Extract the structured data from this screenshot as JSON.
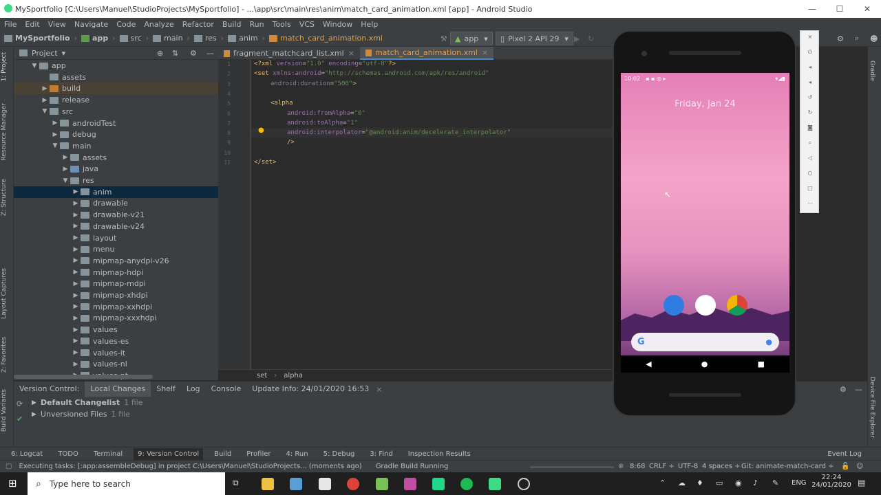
{
  "window": {
    "title": "MySportfolio [C:\\Users\\Manuel\\StudioProjects\\MySportfolio] - ...\\app\\src\\main\\res\\anim\\match_card_animation.xml [app] - Android Studio",
    "minimize": "—",
    "maximize": "☐",
    "close": "✕"
  },
  "menu": [
    "File",
    "Edit",
    "View",
    "Navigate",
    "Code",
    "Analyze",
    "Refactor",
    "Build",
    "Run",
    "Tools",
    "VCS",
    "Window",
    "Help"
  ],
  "breadcrumbs": [
    "MySportfolio",
    "app",
    "src",
    "main",
    "res",
    "anim",
    "match_card_animation.xml"
  ],
  "toolbar": {
    "run_config": "app",
    "device": "Pixel 2 API 29"
  },
  "left_strip": {
    "project": "1: Project",
    "resource": "Resource Manager",
    "structure": "Z: Structure",
    "captures": "Layout Captures",
    "favorites": "2: Favorites",
    "variants": "Build Variants"
  },
  "project_panel": {
    "title": "Project"
  },
  "tree": [
    {
      "label": "app",
      "depth": 1,
      "arrow": "▼",
      "color": "gray"
    },
    {
      "label": "assets",
      "depth": 2,
      "arrow": "",
      "color": "gray"
    },
    {
      "label": "build",
      "depth": 2,
      "arrow": "▶",
      "color": "orange"
    },
    {
      "label": "release",
      "depth": 2,
      "arrow": "▶",
      "color": "gray"
    },
    {
      "label": "src",
      "depth": 2,
      "arrow": "▼",
      "color": "gray"
    },
    {
      "label": "androidTest",
      "depth": 3,
      "arrow": "▶",
      "color": "gray"
    },
    {
      "label": "debug",
      "depth": 3,
      "arrow": "▶",
      "color": "gray"
    },
    {
      "label": "main",
      "depth": 3,
      "arrow": "▼",
      "color": "gray"
    },
    {
      "label": "assets",
      "depth": 4,
      "arrow": "▶",
      "color": "gray"
    },
    {
      "label": "java",
      "depth": 4,
      "arrow": "▶",
      "color": "blue"
    },
    {
      "label": "res",
      "depth": 4,
      "arrow": "▼",
      "color": "gray"
    },
    {
      "label": "anim",
      "depth": 5,
      "arrow": "▶",
      "color": "gray",
      "selected": true
    },
    {
      "label": "drawable",
      "depth": 5,
      "arrow": "▶",
      "color": "gray"
    },
    {
      "label": "drawable-v21",
      "depth": 5,
      "arrow": "▶",
      "color": "gray"
    },
    {
      "label": "drawable-v24",
      "depth": 5,
      "arrow": "▶",
      "color": "gray"
    },
    {
      "label": "layout",
      "depth": 5,
      "arrow": "▶",
      "color": "gray"
    },
    {
      "label": "menu",
      "depth": 5,
      "arrow": "▶",
      "color": "gray"
    },
    {
      "label": "mipmap-anydpi-v26",
      "depth": 5,
      "arrow": "▶",
      "color": "gray"
    },
    {
      "label": "mipmap-hdpi",
      "depth": 5,
      "arrow": "▶",
      "color": "gray"
    },
    {
      "label": "mipmap-mdpi",
      "depth": 5,
      "arrow": "▶",
      "color": "gray"
    },
    {
      "label": "mipmap-xhdpi",
      "depth": 5,
      "arrow": "▶",
      "color": "gray"
    },
    {
      "label": "mipmap-xxhdpi",
      "depth": 5,
      "arrow": "▶",
      "color": "gray"
    },
    {
      "label": "mipmap-xxxhdpi",
      "depth": 5,
      "arrow": "▶",
      "color": "gray"
    },
    {
      "label": "values",
      "depth": 5,
      "arrow": "▶",
      "color": "gray"
    },
    {
      "label": "values-es",
      "depth": 5,
      "arrow": "▶",
      "color": "gray"
    },
    {
      "label": "values-it",
      "depth": 5,
      "arrow": "▶",
      "color": "gray"
    },
    {
      "label": "values-nl",
      "depth": 5,
      "arrow": "▶",
      "color": "gray"
    },
    {
      "label": "values-pt",
      "depth": 5,
      "arrow": "▶",
      "color": "gray"
    }
  ],
  "editor_tabs": [
    {
      "label": "fragment_matchcard_list.xml",
      "active": false
    },
    {
      "label": "match_card_animation.xml",
      "active": true
    }
  ],
  "code_lines": [
    {
      "n": "1",
      "parts": [
        [
          "kw",
          "<?xml "
        ],
        [
          "attr",
          "version"
        ],
        [
          "pl",
          "="
        ],
        [
          "str",
          "\"1.0\""
        ],
        [
          "pl",
          " "
        ],
        [
          "attr",
          "encoding"
        ],
        [
          "pl",
          "="
        ],
        [
          "str",
          "\"utf-8\""
        ],
        [
          "kw",
          "?>"
        ]
      ],
      "indent": 0
    },
    {
      "n": "2",
      "parts": [
        [
          "kw",
          "<set "
        ],
        [
          "attr",
          "xmlns:android"
        ],
        [
          "pl",
          "="
        ],
        [
          "str",
          "\"http://schemas.android.com/apk/res/android\""
        ]
      ],
      "indent": 0
    },
    {
      "n": "3",
      "parts": [
        [
          "attr",
          "android:duration"
        ],
        [
          "pl",
          "="
        ],
        [
          "str",
          "\"500\""
        ],
        [
          "kw",
          ">"
        ]
      ],
      "indent": 2
    },
    {
      "n": "4",
      "parts": [],
      "indent": 0
    },
    {
      "n": "5",
      "parts": [
        [
          "kw",
          "<alpha"
        ]
      ],
      "indent": 2
    },
    {
      "n": "6",
      "parts": [
        [
          "attr",
          "android:fromAlpha"
        ],
        [
          "pl",
          "="
        ],
        [
          "str",
          "\"0\""
        ]
      ],
      "indent": 4
    },
    {
      "n": "7",
      "parts": [
        [
          "attr",
          "android:toAlpha"
        ],
        [
          "pl",
          "="
        ],
        [
          "str",
          "\"1\""
        ]
      ],
      "indent": 4
    },
    {
      "n": "8",
      "parts": [
        [
          "attr",
          "android:interpolator"
        ],
        [
          "pl",
          "="
        ],
        [
          "str",
          "\"@android:anim/decelerate_interpolator\""
        ]
      ],
      "indent": 4
    },
    {
      "n": "9",
      "parts": [
        [
          "kw",
          "/>"
        ]
      ],
      "indent": 4
    },
    {
      "n": "10",
      "parts": [],
      "indent": 0
    },
    {
      "n": "11",
      "parts": [
        [
          "kw",
          "</set>"
        ]
      ],
      "indent": 0
    }
  ],
  "editor_breadcrumb": [
    "set",
    "alpha"
  ],
  "version_control": {
    "label": "Version Control:",
    "tabs": [
      "Local Changes",
      "Shelf",
      "Log",
      "Console",
      "Update Info: 24/01/2020 16:53"
    ],
    "changelist": "Default Changelist",
    "changelist_count": "1 file",
    "unversioned": "Unversioned Files",
    "unversioned_count": "1 file"
  },
  "bottom_tabs": [
    "6: Logcat",
    "TODO",
    "Terminal",
    "9: Version Control",
    "Build",
    "Profiler",
    "4: Run",
    "5: Debug",
    "3: Find",
    "Inspection Results"
  ],
  "event_log": "Event Log",
  "status": {
    "message": "Executing tasks: [:app:assembleDebug] in project C:\\Users\\Manuel\\StudioProjects... (moments ago)",
    "gradle": "Gradle Build Running",
    "position": "8:68",
    "line_sep": "CRLF ÷",
    "encoding": "UTF-8",
    "indent": "4 spaces ÷",
    "git": "Git: animate-match-card ÷"
  },
  "right_strip": {
    "gradle": "Gradle",
    "device_explorer": "Device File Explorer"
  },
  "emulator": {
    "time": "10:02",
    "date": "Friday, Jan 24"
  },
  "taskbar": {
    "search_placeholder": "Type here to search",
    "language": "ENG",
    "time": "22:24",
    "date": "24/01/2020"
  }
}
